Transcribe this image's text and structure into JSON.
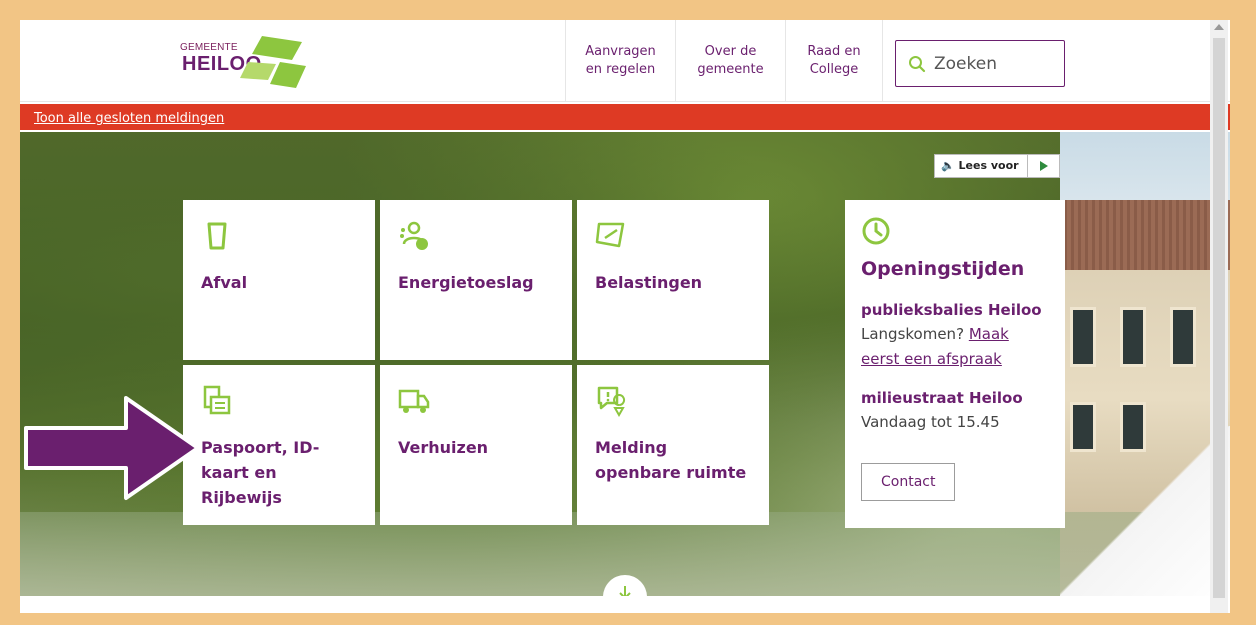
{
  "header": {
    "logo_small": "GEMEENTE",
    "logo_big": "HEILOO",
    "nav": [
      {
        "label": "Aanvragen\nen regelen"
      },
      {
        "label": "Over de\ngemeente"
      },
      {
        "label": "Raad en\nCollege"
      }
    ],
    "search_placeholder": "Zoeken"
  },
  "alert": {
    "link": "Toon alle gesloten meldingen"
  },
  "readaloud": {
    "label": "Lees voor"
  },
  "tiles": [
    {
      "label": "Afval",
      "icon": "waste-bin-icon"
    },
    {
      "label": "Energietoeslag",
      "icon": "energy-allowance-icon"
    },
    {
      "label": "Belastingen",
      "icon": "tax-tag-icon"
    },
    {
      "label": "Paspoort, ID-kaart en Rijbewijs",
      "icon": "id-card-icon"
    },
    {
      "label": "Verhuizen",
      "icon": "moving-truck-icon"
    },
    {
      "label": "Melding openbare ruimte",
      "icon": "report-location-icon"
    }
  ],
  "opening": {
    "title": "Openingstijden",
    "loc1": "publieksbalies Heiloo",
    "loc1_prefix": "Langskomen?",
    "loc1_link": "Maak eerst een afspraak",
    "loc2": "milieustraat Heiloo",
    "loc2_text": "Vandaag tot 15.45",
    "contact": "Contact"
  },
  "colors": {
    "brand": "#6a1f6e",
    "accent": "#8dc63f",
    "alert": "#de3a24",
    "frame": "#f2c585"
  }
}
